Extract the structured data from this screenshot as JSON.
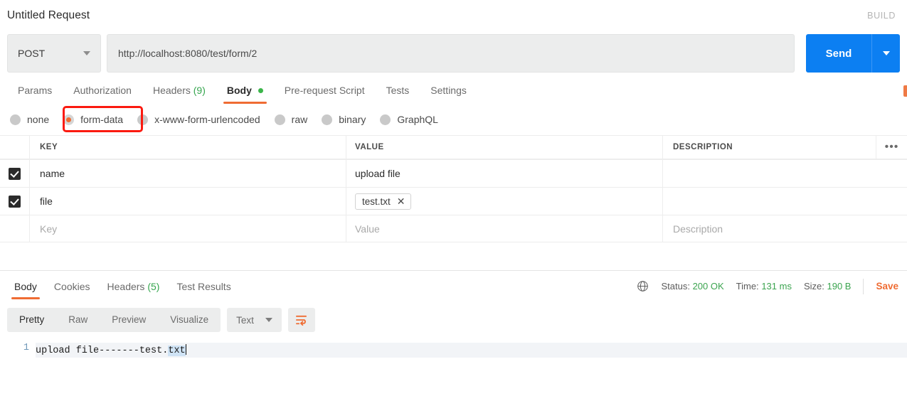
{
  "header": {
    "request_title": "Untitled Request",
    "build_label": "BUILD"
  },
  "url_bar": {
    "method": "POST",
    "url": "http://localhost:8080/test/form/2",
    "send_label": "Send"
  },
  "request_tabs": [
    {
      "label": "Params",
      "active": false
    },
    {
      "label": "Authorization",
      "active": false
    },
    {
      "label": "Headers",
      "count": "(9)",
      "active": false
    },
    {
      "label": "Body",
      "dot": true,
      "active": true
    },
    {
      "label": "Pre-request Script",
      "active": false
    },
    {
      "label": "Tests",
      "active": false
    },
    {
      "label": "Settings",
      "active": false
    }
  ],
  "body_types": [
    {
      "label": "none",
      "selected": false
    },
    {
      "label": "form-data",
      "selected": true,
      "annotated": true
    },
    {
      "label": "x-www-form-urlencoded",
      "selected": false
    },
    {
      "label": "raw",
      "selected": false
    },
    {
      "label": "binary",
      "selected": false
    },
    {
      "label": "GraphQL",
      "selected": false
    }
  ],
  "kv_table": {
    "headers": {
      "key": "KEY",
      "value": "VALUE",
      "description": "DESCRIPTION",
      "more": "•••"
    },
    "rows": [
      {
        "checked": true,
        "key": "name",
        "value": "upload file",
        "value_is_chip": false,
        "description": ""
      },
      {
        "checked": true,
        "key": "file",
        "value": "test.txt",
        "value_is_chip": true,
        "chip_remove": "✕",
        "description": ""
      }
    ],
    "empty_row": {
      "key_placeholder": "Key",
      "value_placeholder": "Value",
      "description_placeholder": "Description"
    }
  },
  "response": {
    "tabs": [
      {
        "label": "Body",
        "active": true
      },
      {
        "label": "Cookies",
        "active": false
      },
      {
        "label": "Headers",
        "count": "(5)",
        "active": false
      },
      {
        "label": "Test Results",
        "active": false
      }
    ],
    "status_label": "Status:",
    "status_value": "200 OK",
    "time_label": "Time:",
    "time_value": "131 ms",
    "size_label": "Size:",
    "size_value": "190 B",
    "save_label": "Save",
    "toolbar": {
      "views": [
        {
          "label": "Pretty",
          "active": true
        },
        {
          "label": "Raw",
          "active": false
        },
        {
          "label": "Preview",
          "active": false
        },
        {
          "label": "Visualize",
          "active": false
        }
      ],
      "format": "Text"
    },
    "code": {
      "line_number": "1",
      "text_before_selection": "upload file-------test.",
      "selected_text": "txt"
    }
  },
  "colors": {
    "accent_orange": "#ef6c33",
    "send_blue": "#0c7ff2",
    "status_green": "#3ba44f",
    "annotation_red": "#fb1a10"
  }
}
